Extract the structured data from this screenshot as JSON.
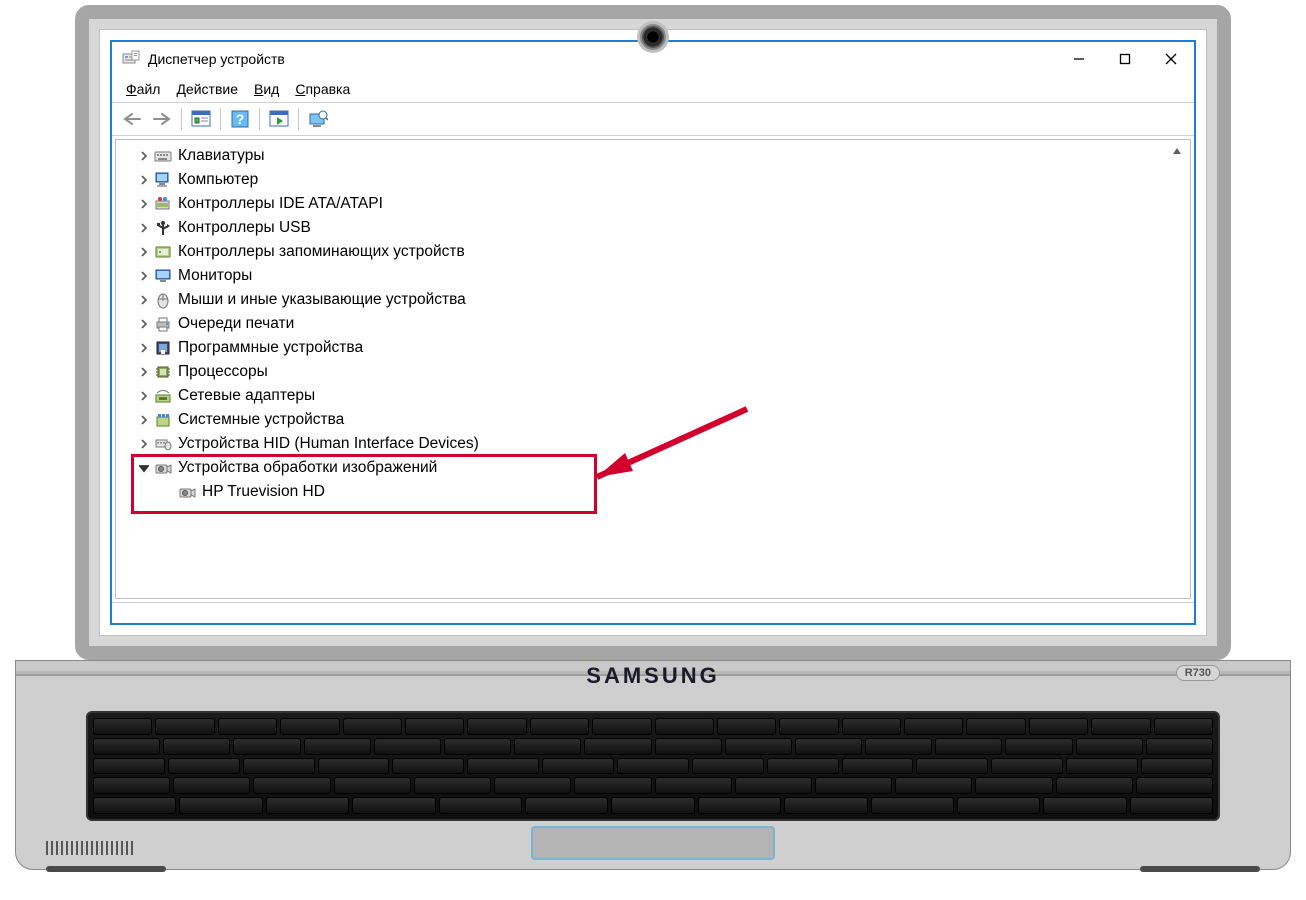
{
  "laptop": {
    "brand": "SAMSUNG",
    "model": "R730"
  },
  "window": {
    "title": "Диспетчер устройств",
    "menus": {
      "file": "Файл",
      "action": "Действие",
      "view": "Вид",
      "help": "Справка"
    }
  },
  "tree": {
    "items": [
      {
        "id": "keyboards",
        "label": "Клавиатуры",
        "expanded": false,
        "icon": "keyboard"
      },
      {
        "id": "computer",
        "label": "Компьютер",
        "expanded": false,
        "icon": "computer"
      },
      {
        "id": "ide",
        "label": "Контроллеры IDE ATA/ATAPI",
        "expanded": false,
        "icon": "ide"
      },
      {
        "id": "usb",
        "label": "Контроллеры USB",
        "expanded": false,
        "icon": "usb"
      },
      {
        "id": "storage",
        "label": "Контроллеры запоминающих устройств",
        "expanded": false,
        "icon": "storage"
      },
      {
        "id": "monitors",
        "label": "Мониторы",
        "expanded": false,
        "icon": "monitor"
      },
      {
        "id": "mice",
        "label": "Мыши и иные указывающие устройства",
        "expanded": false,
        "icon": "mouse"
      },
      {
        "id": "printq",
        "label": "Очереди печати",
        "expanded": false,
        "icon": "printer"
      },
      {
        "id": "software",
        "label": "Программные устройства",
        "expanded": false,
        "icon": "soft"
      },
      {
        "id": "cpu",
        "label": "Процессоры",
        "expanded": false,
        "icon": "cpu"
      },
      {
        "id": "net",
        "label": "Сетевые адаптеры",
        "expanded": false,
        "icon": "net"
      },
      {
        "id": "system",
        "label": "Системные устройства",
        "expanded": false,
        "icon": "system"
      },
      {
        "id": "hid",
        "label": "Устройства HID (Human Interface Devices)",
        "expanded": false,
        "icon": "hid"
      },
      {
        "id": "imaging",
        "label": "Устройства обработки изображений",
        "expanded": true,
        "icon": "camera",
        "children": [
          {
            "id": "hp-cam",
            "label": "HP Truevision HD",
            "icon": "camera"
          }
        ]
      }
    ]
  },
  "highlight": {
    "target_category": "imaging",
    "target_device": "hp-cam"
  }
}
